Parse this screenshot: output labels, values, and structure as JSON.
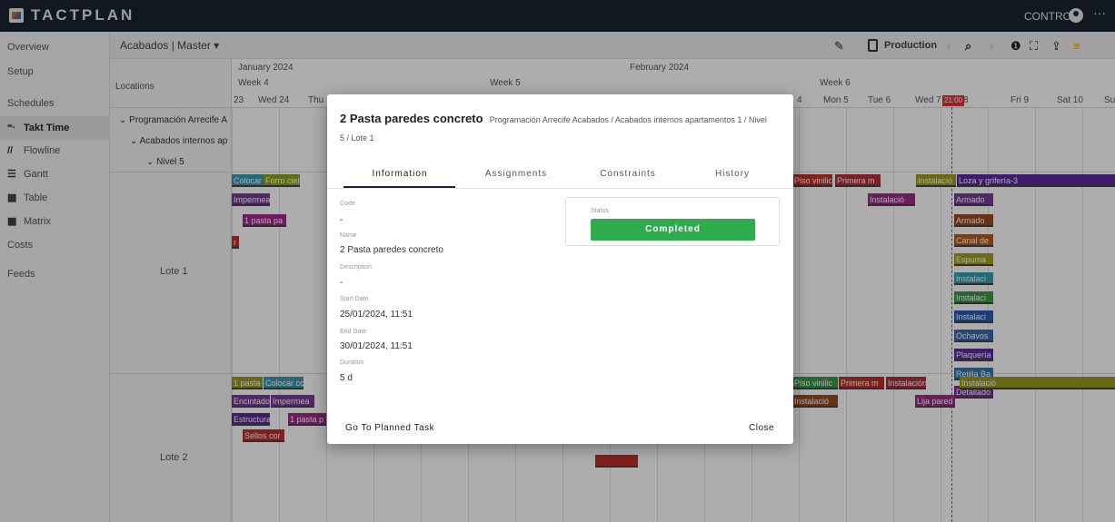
{
  "app": {
    "logo": "TACTPLAN",
    "control_label": "CONTROL",
    "more": "···"
  },
  "sidebar": {
    "items": [
      {
        "label": "Overview",
        "icon": ""
      },
      {
        "label": "Setup",
        "icon": ""
      },
      {
        "label": "Schedules",
        "icon": ""
      },
      {
        "label": "Takt Time",
        "icon": "takt-icon",
        "glyph": "⁼·",
        "active": true
      },
      {
        "label": "Flowline",
        "icon": "flowline-icon",
        "glyph": "//"
      },
      {
        "label": "Gantt",
        "icon": "gantt-icon",
        "glyph": "☰"
      },
      {
        "label": "Table",
        "icon": "table-icon",
        "glyph": "▦"
      },
      {
        "label": "Matrix",
        "icon": "matrix-icon",
        "glyph": "▩"
      },
      {
        "label": "Costs",
        "icon": ""
      },
      {
        "label": "Feeds",
        "icon": ""
      }
    ]
  },
  "subbar": {
    "breadcrumb": "Acabados | Master ▾",
    "production_label": "Production",
    "edit_glyph": "✎",
    "search_glyph": "⌕",
    "info_glyph": "❶",
    "expand_glyph": "⛶",
    "share_glyph": "⇪",
    "filter_glyph": "≡",
    "prev_glyph": "‹",
    "next_glyph": "›"
  },
  "timeline": {
    "locations_header": "Locations",
    "months": [
      {
        "label": "January 2024"
      },
      {
        "label": "February 2024"
      }
    ],
    "weeks": [
      {
        "label": "Week 4"
      },
      {
        "label": "Week 5"
      },
      {
        "label": "Week 6"
      }
    ],
    "days": [
      "23",
      "Wed 24",
      "Thu",
      "4",
      "Mon 5",
      "Tue 6",
      "Wed 7",
      "8",
      "Fri 9",
      "Sat 10",
      "Su"
    ],
    "today_badge": "21:00",
    "tree": [
      "Programación Arrecife A",
      "Acabados internos ap",
      "Nivel 5"
    ],
    "rows": [
      "Lote 1",
      "Lote 2"
    ],
    "chips_left": [
      "Colocar cc",
      "Forro cielc",
      "Impermea",
      "1 pasta pa",
      "r",
      "1 pasta pa",
      "Colocar cc",
      "Encintado",
      "Impermea",
      "Estructura",
      "1 pasta p",
      "Sellos cor"
    ],
    "chips_right": [
      "Piso vinilic",
      "Primera m",
      "Instalació",
      "Loza y grifería-3",
      "Instalació",
      "Armado",
      "Armado",
      "Canal de",
      "Espuma",
      "Instalaci",
      "Instalaci",
      "Instalaci",
      "Ochavos",
      "Plaquería",
      "Rejilla Ba",
      "Detallado",
      "Piso vinilic",
      "Primera m",
      "Instalación de sobres 3",
      "Instalació",
      "Instalació",
      "Lija pared"
    ]
  },
  "modal": {
    "title": "2 Pasta paredes concreto",
    "path": "Programación Arrecife Acabados / Acabados internos apartamentos 1 / Nivel",
    "path2": "5 / Lote 1",
    "tabs": [
      "Information",
      "Assignments",
      "Constraints",
      "History"
    ],
    "fields": {
      "code_label": "Code",
      "code": "-",
      "name_label": "Name",
      "name": "2 Pasta paredes concreto",
      "description_label": "Description",
      "description": "-",
      "start_label": "Start Date",
      "start": "25/01/2024, 11:51",
      "end_label": "End Date",
      "end": "30/01/2024, 11:51",
      "duration_label": "Duration",
      "duration": "5 d"
    },
    "status_label": "Status",
    "status": "Completed",
    "status_color": "#2fac4c",
    "go_label": "Go To Planned Task",
    "close_label": "Close"
  }
}
